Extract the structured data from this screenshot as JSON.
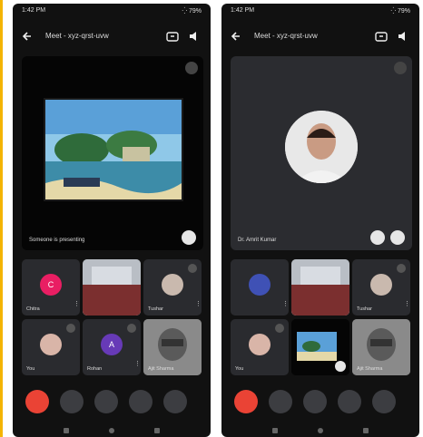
{
  "left": {
    "status": {
      "left": "1:42 PM",
      "right": "⁛ 79%"
    },
    "meeting_title": "Meet - xyz-qrst-uvw",
    "caption": "Someone is presenting",
    "tiles": [
      {
        "name": "Chitra"
      },
      {
        "name": ""
      },
      {
        "name": "Tushar"
      },
      {
        "name": "You"
      },
      {
        "name": "Rohan",
        "initial": "A"
      },
      {
        "name": "Ajit Sharma"
      }
    ]
  },
  "right": {
    "status": {
      "left": "1:42 PM",
      "right": "⁛ 79%"
    },
    "meeting_title": "Meet - xyz-qrst-uvw",
    "caption": "Dr. Amrit Kumar",
    "tiles": [
      {
        "name": ""
      },
      {
        "name": ""
      },
      {
        "name": "Tushar"
      },
      {
        "name": "You"
      },
      {
        "name": ""
      },
      {
        "name": "Ajit Sharma"
      }
    ]
  },
  "colors": {
    "accent": "#ea4335",
    "brand_bar": "#f4b400"
  }
}
